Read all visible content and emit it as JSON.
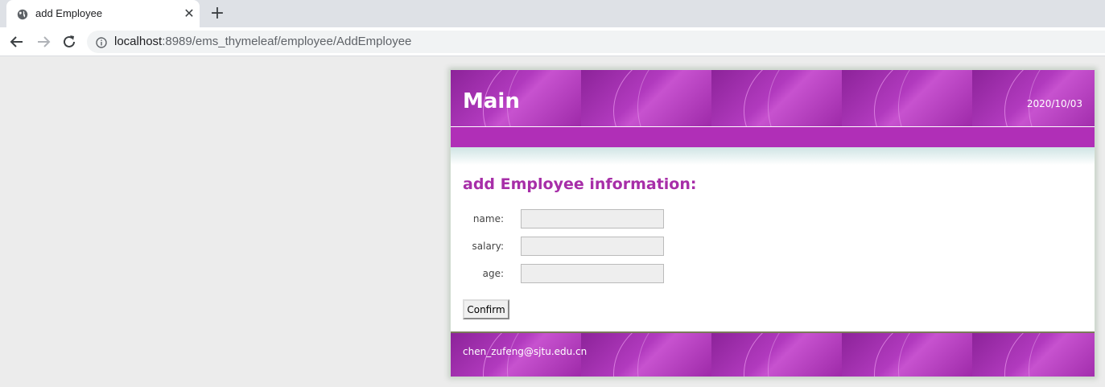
{
  "browser": {
    "tab": {
      "title": "add Employee",
      "close_glyph": "✕"
    },
    "new_tab_glyph": "+",
    "address_bar": {
      "url_host": "localhost",
      "url_rest": ":8989/ems_thymeleaf/employee/AddEmployee"
    }
  },
  "page": {
    "header": {
      "title": "Main",
      "date": "2020/10/03"
    },
    "form": {
      "heading": "add Employee information:",
      "fields": [
        {
          "label": "name:",
          "value": ""
        },
        {
          "label": "salary:",
          "value": ""
        },
        {
          "label": "age:",
          "value": ""
        }
      ],
      "submit_label": "Confirm"
    },
    "footer": {
      "email": "chen_zufeng@sjtu.edu.cn"
    }
  },
  "colors": {
    "accent": "#a72ea8",
    "header_bg": "#9b2aa6",
    "nav_bar": "#b02fb7"
  },
  "icons": [
    "globe-icon",
    "close-icon",
    "plus-icon",
    "back-arrow-icon",
    "forward-arrow-icon",
    "reload-icon",
    "info-icon"
  ]
}
